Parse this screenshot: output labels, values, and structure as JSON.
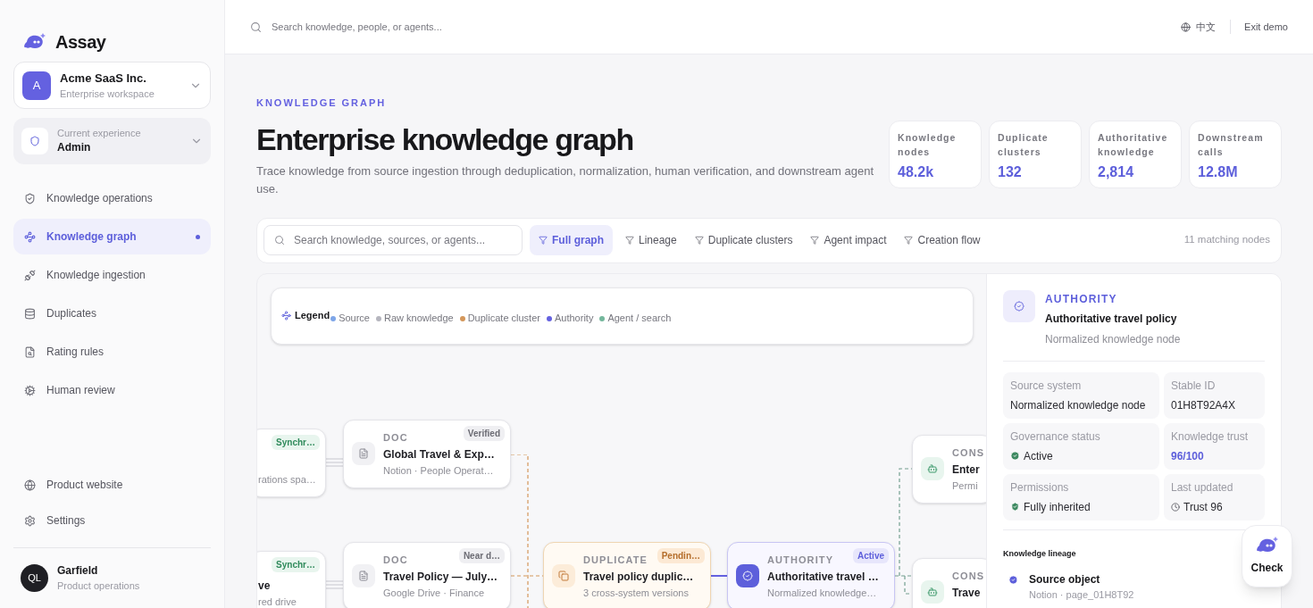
{
  "brand": {
    "name": "Assay"
  },
  "workspace": {
    "initial": "A",
    "name": "Acme SaaS Inc.",
    "subtitle": "Enterprise workspace"
  },
  "experience": {
    "label": "Current experience",
    "value": "Admin"
  },
  "nav": [
    {
      "label": "Knowledge operations",
      "selected": false
    },
    {
      "label": "Knowledge graph",
      "selected": true
    },
    {
      "label": "Knowledge ingestion",
      "selected": false
    },
    {
      "label": "Duplicates",
      "selected": false
    },
    {
      "label": "Rating rules",
      "selected": false
    },
    {
      "label": "Human review",
      "selected": false
    }
  ],
  "footer_nav": [
    {
      "label": "Product website"
    },
    {
      "label": "Settings"
    }
  ],
  "user": {
    "initials": "QL",
    "name": "Garfield",
    "role": "Product operations"
  },
  "topbar": {
    "search_placeholder": "Search knowledge, people, or agents...",
    "language": "中文",
    "exit": "Exit demo"
  },
  "header": {
    "eyebrow": "KNOWLEDGE GRAPH",
    "title": "Enterprise knowledge graph",
    "description": "Trace knowledge from source ingestion through deduplication, normalization, human verification, and downstream agent use."
  },
  "stats": [
    {
      "label": "Knowledge nodes",
      "value": "48.2k"
    },
    {
      "label": "Duplicate clusters",
      "value": "132"
    },
    {
      "label": "Authoritative knowledge",
      "value": "2,814"
    },
    {
      "label": "Downstream calls",
      "value": "12.8M"
    }
  ],
  "filters": {
    "search_placeholder": "Search knowledge, sources, or agents...",
    "tabs": [
      {
        "label": "Full graph",
        "selected": true
      },
      {
        "label": "Lineage",
        "selected": false
      },
      {
        "label": "Duplicate clusters",
        "selected": false
      },
      {
        "label": "Agent impact",
        "selected": false
      },
      {
        "label": "Creation flow",
        "selected": false
      }
    ],
    "count": "11 matching nodes"
  },
  "legend": {
    "title": "Legend",
    "items": [
      {
        "label": "Source",
        "color": "#7ea6e8"
      },
      {
        "label": "Raw knowledge",
        "color": "#b5b5be"
      },
      {
        "label": "Duplicate cluster",
        "color": "#d4975a"
      },
      {
        "label": "Authority",
        "color": "#6461e0"
      },
      {
        "label": "Agent / search",
        "color": "#74b79c"
      }
    ]
  },
  "nodes": [
    {
      "kind": "source",
      "badge": "Synchr…",
      "subtitle": "rations spa…"
    },
    {
      "kind": "source",
      "badge": "Synchr…",
      "title": "ve",
      "subtitle": "red drive"
    },
    {
      "kind": "doc",
      "type_label": "DOC",
      "badge": "Verified",
      "title": "Global Travel & Exp…",
      "subtitle": "Notion · People Operat…"
    },
    {
      "kind": "doc",
      "type_label": "DOC",
      "badge": "Near d…",
      "title": "Travel Policy — July…",
      "subtitle": "Google Drive · Finance"
    },
    {
      "kind": "duplicate",
      "type_label": "DUPLICATE",
      "badge": "Pendin…",
      "title": "Travel policy duplic…",
      "subtitle": "3 cross-system versions"
    },
    {
      "kind": "authority",
      "type_label": "AUTHORITY",
      "badge": "Active",
      "title": "Authoritative travel …",
      "subtitle": "Normalized knowledge…"
    },
    {
      "kind": "consumer",
      "type_label": "CONS",
      "title": "Enter",
      "subtitle": "Permi"
    },
    {
      "kind": "consumer",
      "type_label": "CONS",
      "title": "Trave"
    }
  ],
  "detail": {
    "type_label": "AUTHORITY",
    "title": "Authoritative travel policy",
    "subtitle": "Normalized knowledge node",
    "fields": [
      {
        "label": "Source system",
        "value": "Normalized knowledge node",
        "kind": "plain"
      },
      {
        "label": "Stable ID",
        "value": "01H8T92A4X",
        "kind": "plain"
      },
      {
        "label": "Governance status",
        "value": "Active",
        "kind": "status"
      },
      {
        "label": "Knowledge trust",
        "value": "96/100",
        "kind": "trust"
      },
      {
        "label": "Permissions",
        "value": "Fully inherited",
        "kind": "permission"
      },
      {
        "label": "Last updated",
        "value": "Trust 96",
        "kind": "time"
      }
    ],
    "lineage": {
      "title": "Knowledge lineage",
      "items": [
        {
          "title": "Source object",
          "subtitle": "Notion · page_01H8T92"
        }
      ]
    }
  },
  "assistant": {
    "label": "Check"
  }
}
